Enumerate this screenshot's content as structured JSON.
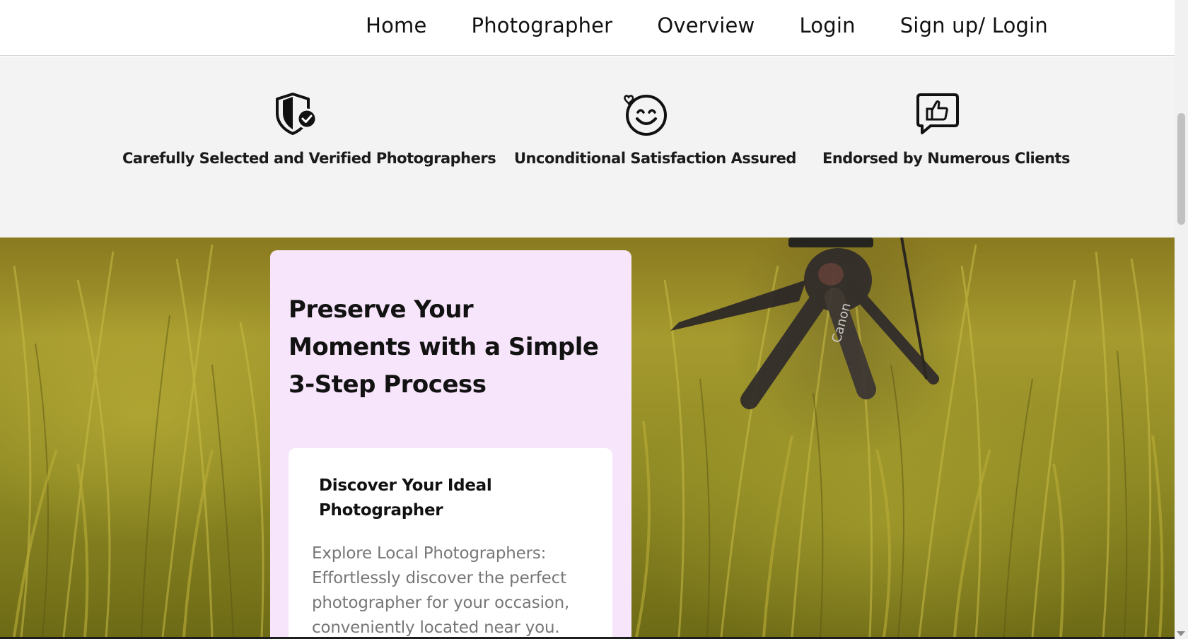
{
  "nav": {
    "items": [
      {
        "label": "Home"
      },
      {
        "label": "Photographer"
      },
      {
        "label": "Overview"
      },
      {
        "label": "Login"
      },
      {
        "label": "Sign up/ Login"
      }
    ]
  },
  "features": [
    {
      "icon": "shield-check-icon",
      "label": "Carefully Selected and Verified Photographers"
    },
    {
      "icon": "smiley-heart-icon",
      "label": "Unconditional Satisfaction Assured"
    },
    {
      "icon": "thumbs-up-chat-icon",
      "label": "Endorsed by Numerous Clients"
    }
  ],
  "process": {
    "title": "Preserve Your Moments with a Simple 3-Step Process",
    "steps": [
      {
        "title": "Discover Your Ideal Photographer",
        "description": "Explore Local Photographers: Effortlessly discover the perfect photographer for your occasion, conveniently located near you."
      }
    ]
  },
  "hero_image": {
    "subject": "camera on tripod in grass",
    "brand_text": "Canon"
  },
  "colors": {
    "card_bg": "#f7e5fb",
    "features_bg": "#f3f3f3",
    "grass": "#9a9026"
  }
}
